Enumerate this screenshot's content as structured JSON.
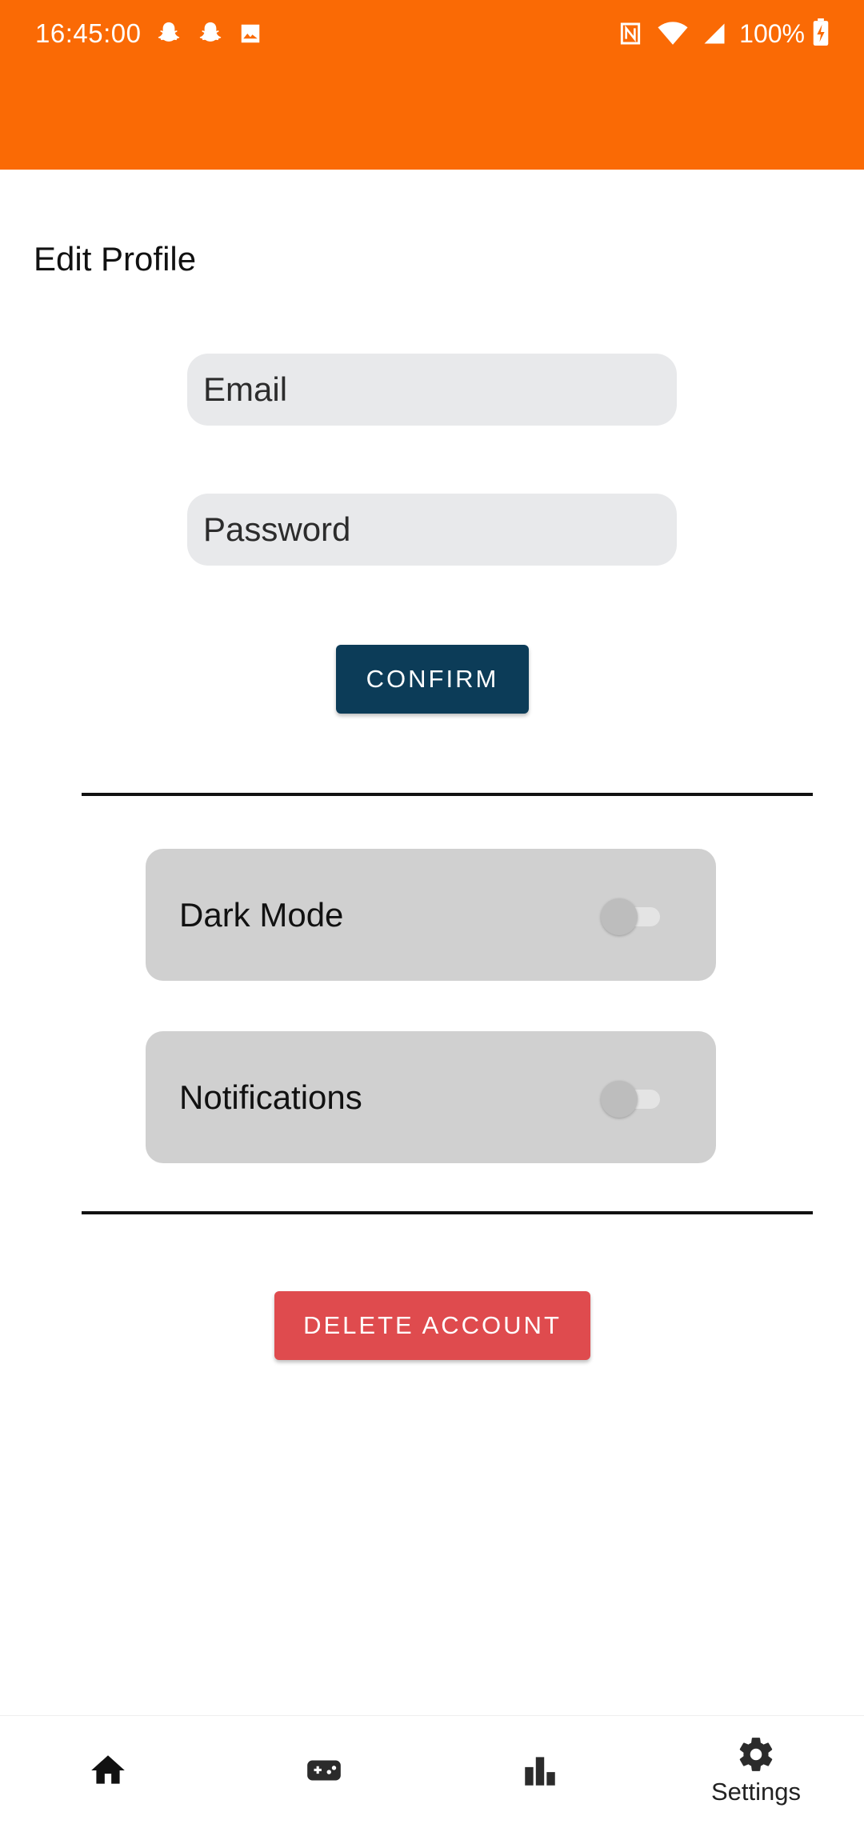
{
  "status_bar": {
    "time": "16:45:00",
    "battery": "100%",
    "left_icons": [
      "snapchat-icon",
      "snapchat-icon",
      "image-icon"
    ],
    "right_icons": [
      "nfc-icon",
      "wifi-icon",
      "signal-icon",
      "battery-charging-icon"
    ]
  },
  "colors": {
    "app_bar": "#fa6a05",
    "confirm_button": "#0c3c58",
    "delete_button": "#df4b4e",
    "input_background": "#e8e9eb",
    "toggle_card_background": "#d0d0d0"
  },
  "profile": {
    "title": "Edit Profile",
    "email_placeholder": "Email",
    "password_placeholder": "Password",
    "confirm_label": "CONFIRM"
  },
  "settings": {
    "dark_mode_label": "Dark Mode",
    "dark_mode_enabled": false,
    "notifications_label": "Notifications",
    "notifications_enabled": false
  },
  "danger": {
    "delete_label": "DELETE ACCOUNT"
  },
  "bottom_nav": {
    "items": [
      {
        "icon": "home-icon",
        "label": ""
      },
      {
        "icon": "gamepad-icon",
        "label": ""
      },
      {
        "icon": "bar-chart-icon",
        "label": ""
      },
      {
        "icon": "gear-icon",
        "label": "Settings"
      }
    ],
    "active_index": 3
  }
}
